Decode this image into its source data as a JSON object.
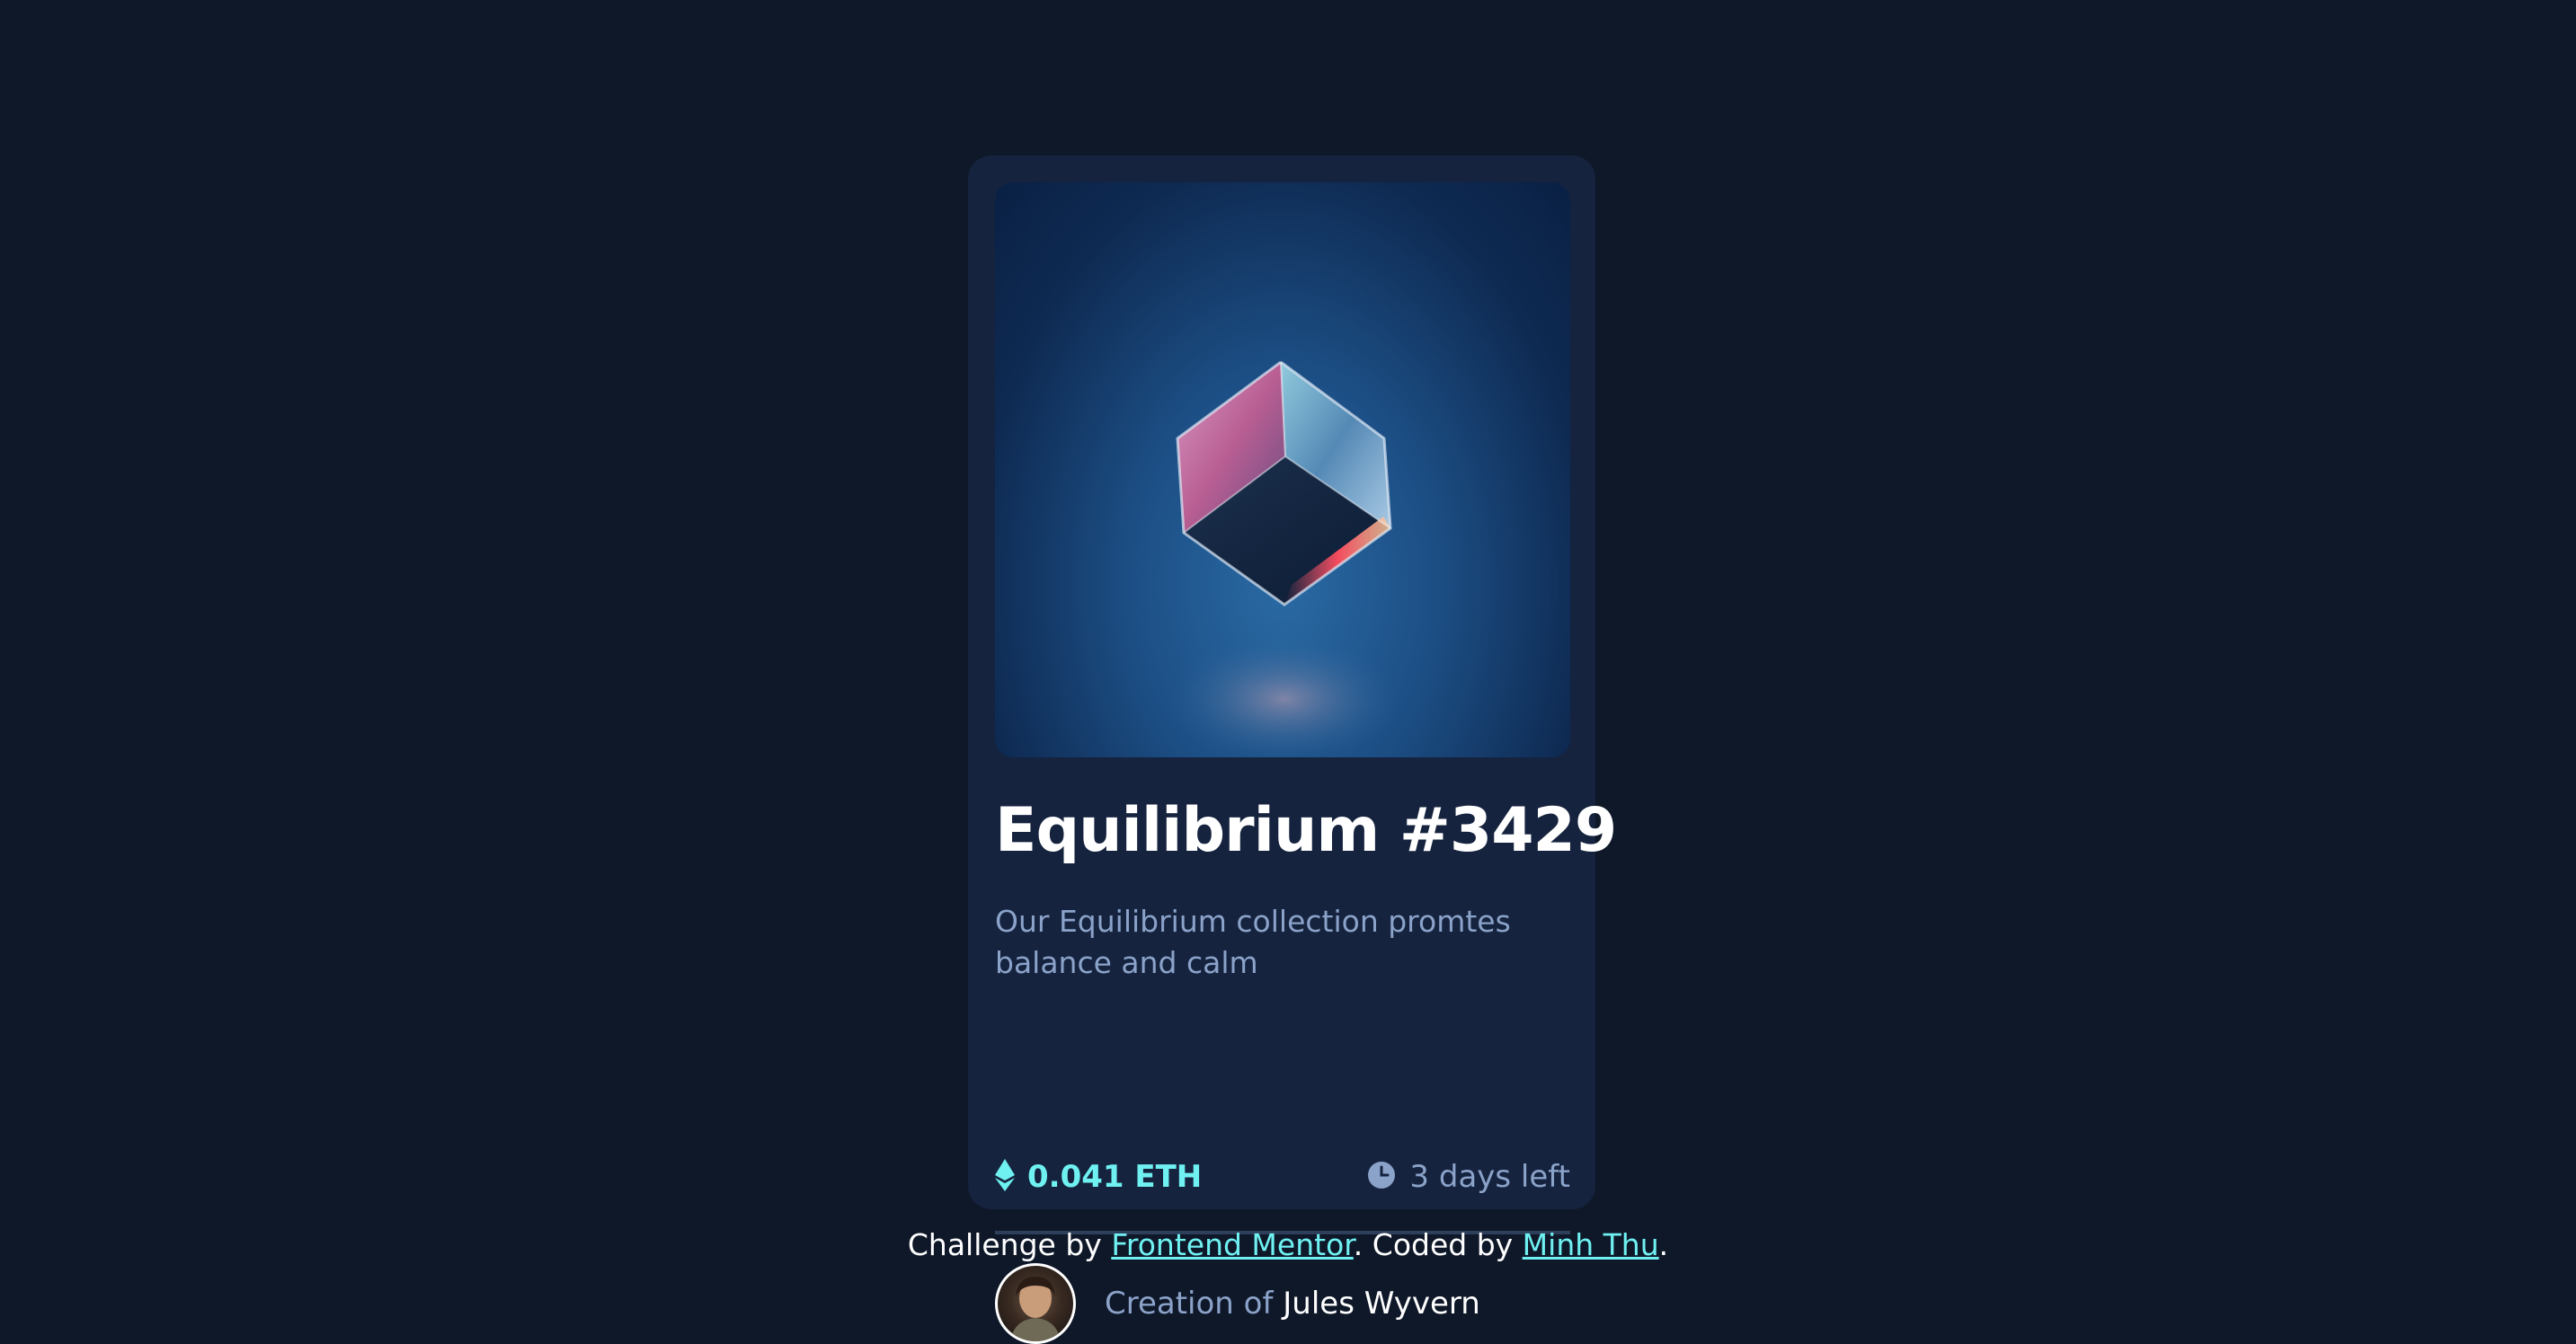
{
  "card": {
    "title": "Equilibrium #3429",
    "description": "Our Equilibrium collection promtes balance and calm",
    "price": "0.041 ETH",
    "time_left": "3 days left",
    "creator_prefix": "Creation of",
    "creator_name": "Jules Wyvern",
    "hero_image": "equilibrium-cube-image"
  },
  "attribution": {
    "prefix": "Challenge by",
    "link1": "Frontend Mentor",
    "middle": ". Coded by",
    "link2": "Minh Thu",
    "suffix": "."
  },
  "icons": {
    "price": "ethereum-icon",
    "time": "clock-icon"
  },
  "colors": {
    "background": "#0f1829",
    "card": "#15233e",
    "accent": "#6ff1f2",
    "muted": "#8ba2c9",
    "heading": "#ffffff",
    "divider": "#2e3f5b"
  }
}
